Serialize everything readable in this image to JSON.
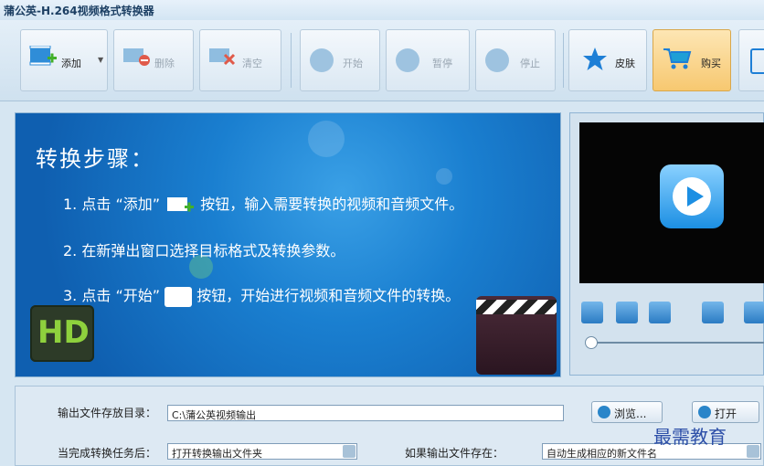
{
  "window": {
    "title": "蒲公英-H.264视频格式转换器"
  },
  "toolbar": {
    "add": "添加",
    "delete": "删除",
    "clear": "清空",
    "start": "开始",
    "pause": "暂停",
    "stop": "停止",
    "skin": "皮肤",
    "buy": "购买"
  },
  "banner": {
    "title": "转换步骤：",
    "step1_a": "1. 点击 “添加”",
    "step1_b": "按钮，输入需要转换的视频和音频文件。",
    "step2": "2. 在新弹出窗口选择目标格式及转换参数。",
    "step3_a": "3. 点击 “开始”",
    "step3_b": "按钮，开始进行视频和音频文件的转换。",
    "hd": "HD"
  },
  "bottom": {
    "output_dir_label": "输出文件存放目录：",
    "output_dir_value": "C:\\蒲公英视频输出",
    "browse": "浏览...",
    "open": "打开",
    "after_done_label": "当完成转换任务后：",
    "after_done_value": "打开转换输出文件夹",
    "if_exists_label": "如果输出文件存在：",
    "if_exists_value": "自动生成相应的新文件名"
  },
  "watermark": "最需教育",
  "colors": {
    "accent": "#2a85c9",
    "banner": "#1a7fd0",
    "buy_highlight": "#fbd48a"
  }
}
